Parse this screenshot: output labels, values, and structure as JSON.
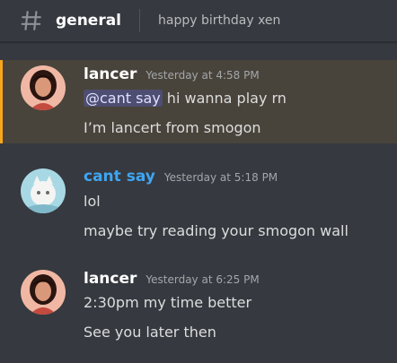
{
  "header": {
    "channel": "general",
    "topic": "happy birthday xen"
  },
  "messages": [
    {
      "author": "lancer",
      "timestamp": "Yesterday at 4:58 PM",
      "mention": "@cant say",
      "line1_rest": " hi wanna play rn",
      "line2": "I’m lancert from smogon"
    },
    {
      "author": "cant say",
      "timestamp": "Yesterday at 5:18 PM",
      "line1": "lol",
      "line2": "maybe try reading your smogon wall"
    },
    {
      "author": "lancer",
      "timestamp": "Yesterday at 6:25 PM",
      "line1": "2:30pm my time better",
      "line2": "See you later then"
    }
  ],
  "colors": {
    "background": "#36393f",
    "mention_highlight_bar": "#faa61a",
    "author_cant_say": "#3ea6f4"
  }
}
